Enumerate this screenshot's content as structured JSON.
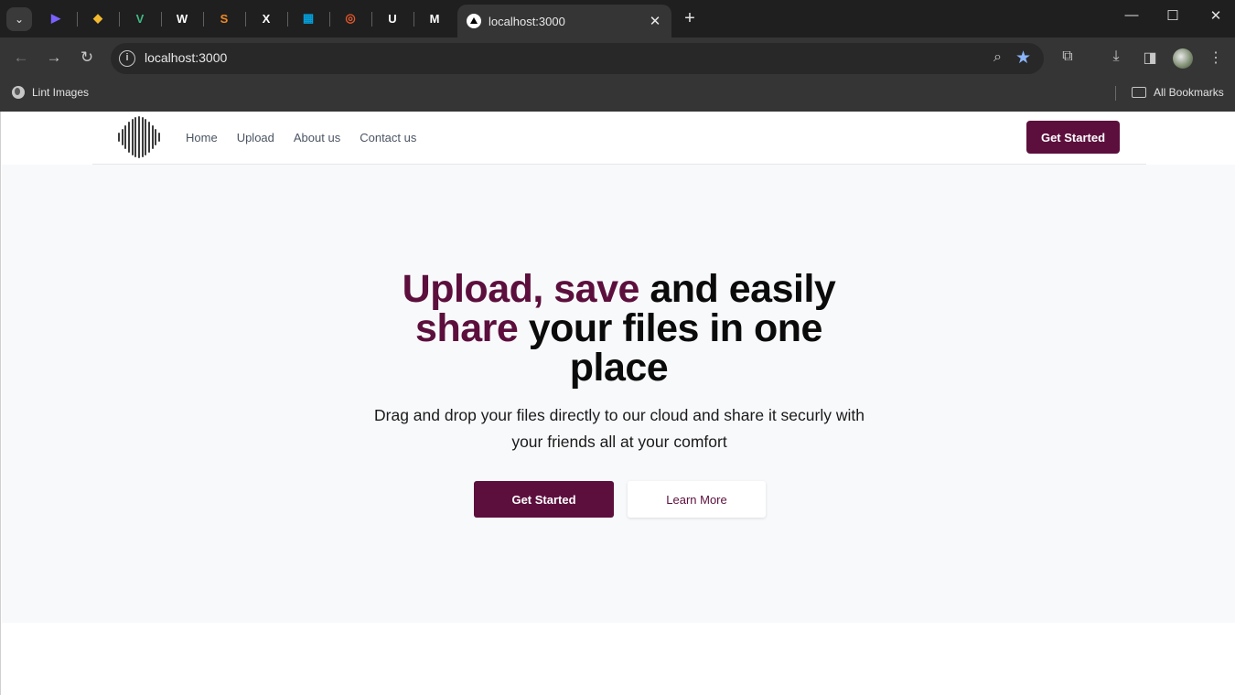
{
  "browser": {
    "tab_title": "localhost:3000",
    "url": "localhost:3000",
    "bookmark_item": "Lint Images",
    "all_bookmarks": "All Bookmarks",
    "pinned_tabs": [
      {
        "icon": "copilot-icon",
        "glyph": "▶",
        "color": "#7b61ff"
      },
      {
        "icon": "binance-icon",
        "glyph": "◆",
        "color": "#f3ba2f"
      },
      {
        "icon": "vue-icon",
        "glyph": "V",
        "color": "#42b883"
      },
      {
        "icon": "webflow-icon",
        "glyph": "W",
        "color": "#ffffff"
      },
      {
        "icon": "s-logo-icon",
        "glyph": "S",
        "color": "#f08a24"
      },
      {
        "icon": "x-icon",
        "glyph": "X",
        "color": "#ffffff"
      },
      {
        "icon": "cisco-icon",
        "glyph": "▦",
        "color": "#049fd9"
      },
      {
        "icon": "orange-app-icon",
        "glyph": "◎",
        "color": "#e2572b"
      },
      {
        "icon": "u-logo-icon",
        "glyph": "U",
        "color": "#ffffff"
      },
      {
        "icon": "m-logo-icon",
        "glyph": "M",
        "color": "#ffffff"
      }
    ]
  },
  "header": {
    "nav": [
      "Home",
      "Upload",
      "About us",
      "Contact us"
    ],
    "cta": "Get Started"
  },
  "hero": {
    "headline_accent_1": "Upload, save",
    "headline_rest_1": " and easily",
    "headline_accent_2": "share",
    "headline_rest_2": " your files in one",
    "headline_line_3": "place",
    "subtitle": "Drag and drop your files directly to our cloud and share it securly with your friends all at your comfort",
    "primary_button": "Get Started",
    "secondary_button": "Learn More"
  },
  "colors": {
    "brand": "#5c0f3d",
    "hero_bg": "#f8f9fb"
  }
}
